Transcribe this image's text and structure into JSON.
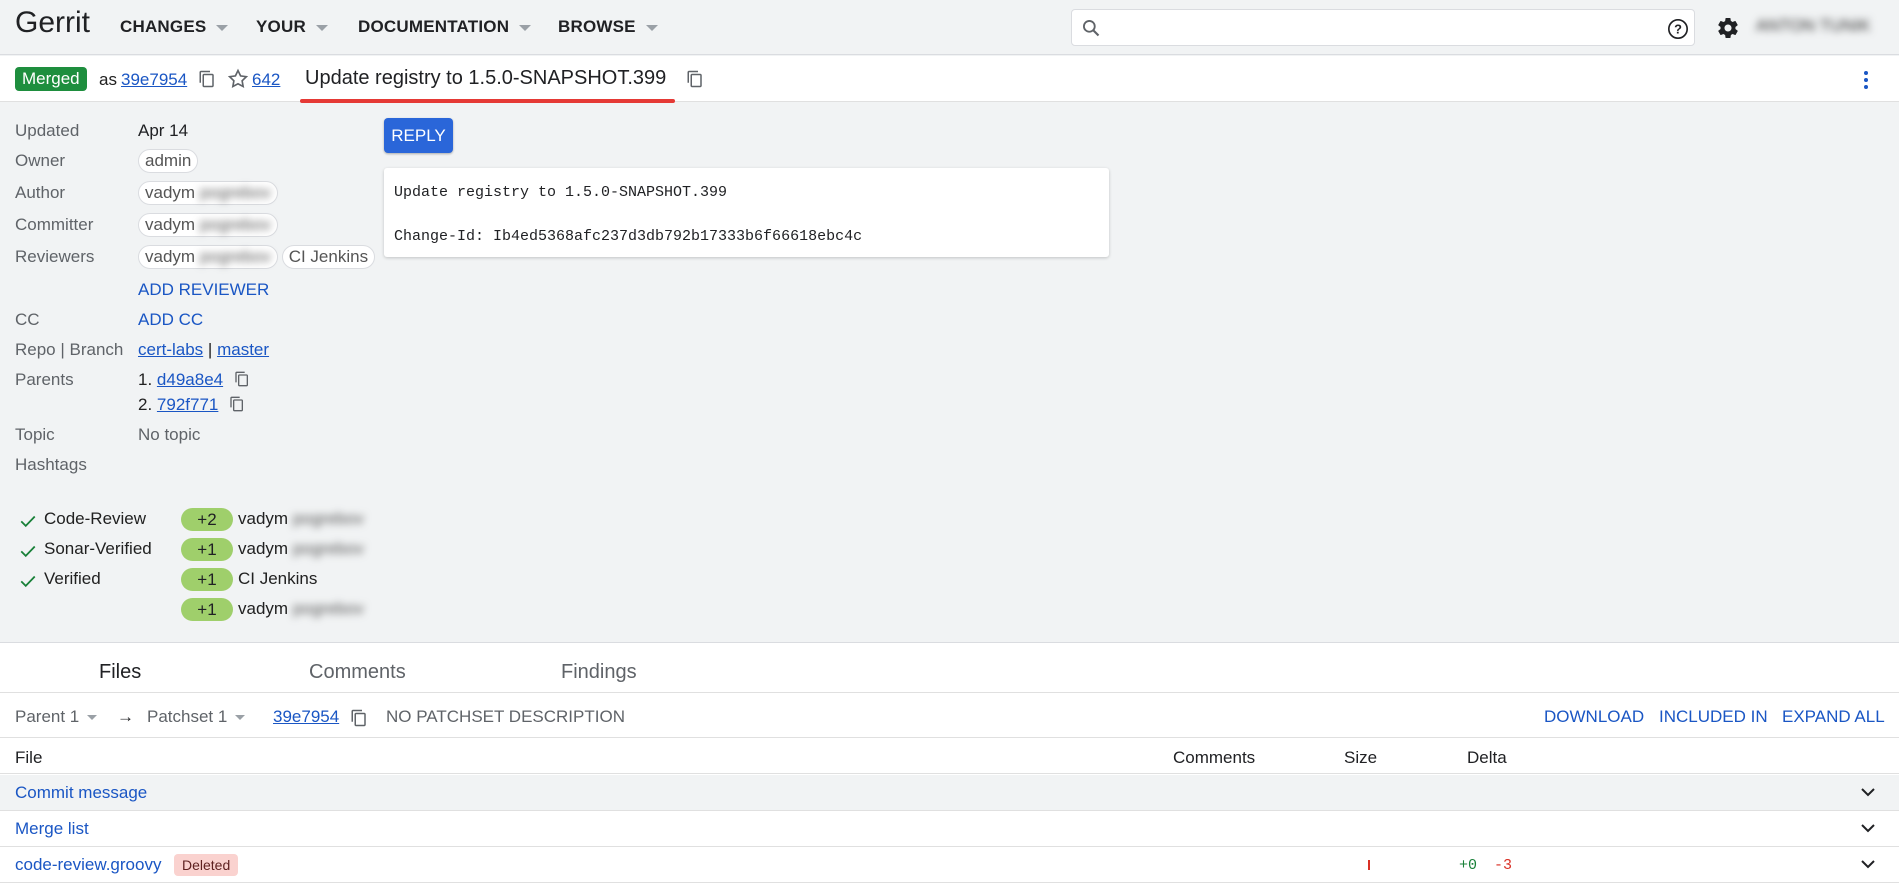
{
  "header": {
    "logo": "Gerrit",
    "menus": [
      {
        "label": "CHANGES"
      },
      {
        "label": "YOUR"
      },
      {
        "label": "DOCUMENTATION"
      },
      {
        "label": "BROWSE"
      }
    ],
    "search_value": "",
    "username": "ANTON TUNIK"
  },
  "change": {
    "status": "Merged",
    "as_label": "as",
    "commit": "39e7954",
    "number": "642",
    "subject": "Update registry to 1.5.0-SNAPSHOT.399"
  },
  "meta": {
    "updated_label": "Updated",
    "updated": "Apr 14",
    "owner_label": "Owner",
    "owner": "admin",
    "author_label": "Author",
    "author": "vadym",
    "author_hidden": "pogrebov",
    "committer_label": "Committer",
    "committer": "vadym",
    "committer_hidden": "pogrebov",
    "reviewers_label": "Reviewers",
    "reviewer1": "vadym",
    "reviewer1_hidden": "pogrebov",
    "reviewer2": "CI Jenkins",
    "add_reviewer": "ADD REVIEWER",
    "cc_label": "CC",
    "add_cc": "ADD CC",
    "repo_label": "Repo | Branch",
    "repo": "cert-labs",
    "separator": "|",
    "branch": "master",
    "parents_label": "Parents",
    "parent1_num": "1.",
    "parent1": "d49a8e4",
    "parent2_num": "2.",
    "parent2": "792f771",
    "topic_label": "Topic",
    "topic": "No topic",
    "hashtags_label": "Hashtags"
  },
  "reply_label": "REPLY",
  "commit_message": "Update registry to 1.5.0-SNAPSHOT.399\n\nChange-Id: Ib4ed5368afc237d3db792b17333b6f66618ebc4c",
  "labels": {
    "code_review": "Code-Review",
    "sonar_verified": "Sonar-Verified",
    "verified": "Verified",
    "votes": [
      {
        "value": "+2",
        "voter": "vadym",
        "voter_hidden": "pogrebov"
      },
      {
        "value": "+1",
        "voter": "vadym",
        "voter_hidden": "pogrebov"
      },
      {
        "value": "+1",
        "voter": "CI Jenkins",
        "voter_hidden": ""
      },
      {
        "value": "+1",
        "voter": "vadym",
        "voter_hidden": "pogrebov"
      }
    ]
  },
  "tabs": [
    {
      "label": "Files"
    },
    {
      "label": "Comments"
    },
    {
      "label": "Findings"
    }
  ],
  "patchset": {
    "base": "Parent 1",
    "arrow": "→",
    "current": "Patchset 1",
    "commit": "39e7954",
    "description": "NO PATCHSET DESCRIPTION",
    "download": "DOWNLOAD",
    "included_in": "INCLUDED IN",
    "expand_all": "EXPAND ALL"
  },
  "file_table": {
    "headers": {
      "file": "File",
      "comments": "Comments",
      "size": "Size",
      "delta": "Delta"
    },
    "rows": [
      {
        "name": "Commit message"
      },
      {
        "name": "Merge list"
      },
      {
        "name": "code-review.groovy",
        "badge": "Deleted",
        "added": "+0",
        "removed": "-3"
      }
    ]
  },
  "colors": {
    "merged": "#1e8e3e",
    "link": "#1a56c4",
    "vote": "#9fcf6b",
    "reply": "#2a66d9",
    "deleted_bg": "#fad2cf",
    "underline": "#e53935"
  }
}
